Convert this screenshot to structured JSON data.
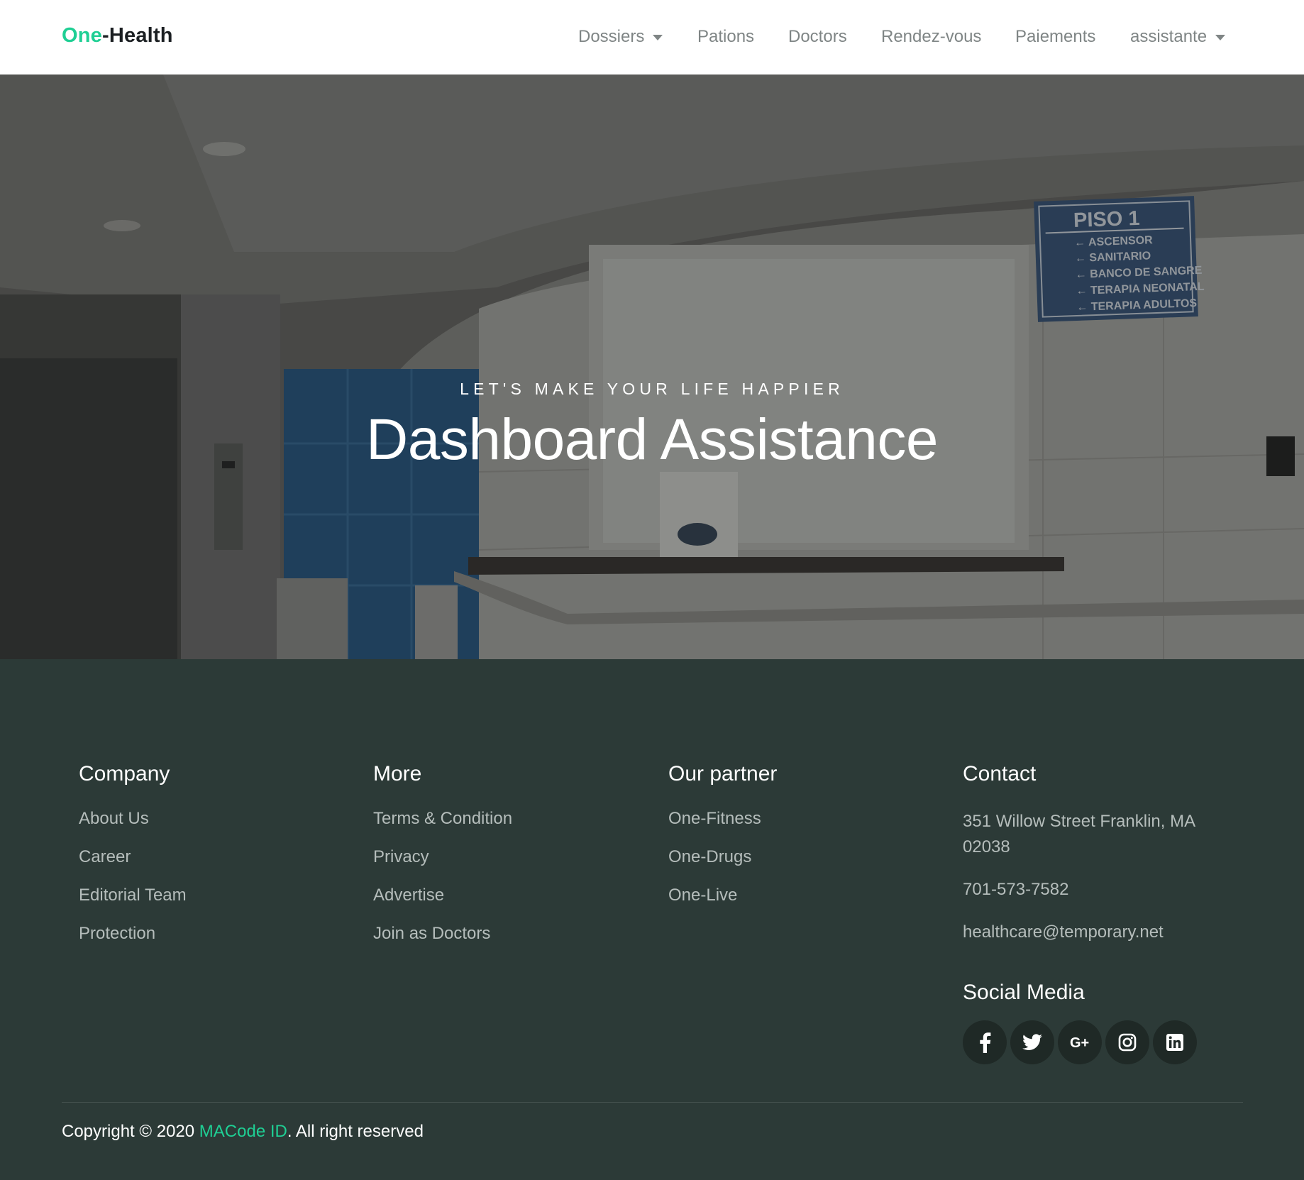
{
  "navbar": {
    "brand_part1": "One",
    "brand_part2": "-Health",
    "items": [
      {
        "label": "Dossiers",
        "dropdown": true
      },
      {
        "label": "Pations",
        "dropdown": false
      },
      {
        "label": "Doctors",
        "dropdown": false
      },
      {
        "label": "Rendez-vous",
        "dropdown": false
      },
      {
        "label": "Paiements",
        "dropdown": false
      },
      {
        "label": "assistante",
        "dropdown": true
      }
    ]
  },
  "hero": {
    "subtitle": "LET'S MAKE YOUR LIFE HAPPIER",
    "title": "Dashboard Assistance",
    "sign": {
      "heading": "PISO 1",
      "lines": [
        "ASCENSOR",
        "SANITARIO",
        "BANCO DE SANGRE",
        "TERAPIA NEONATAL",
        "TERAPIA ADULTOS"
      ]
    }
  },
  "footer": {
    "company": {
      "title": "Company",
      "links": [
        "About Us",
        "Career",
        "Editorial Team",
        "Protection"
      ]
    },
    "more": {
      "title": "More",
      "links": [
        "Terms & Condition",
        "Privacy",
        "Advertise",
        "Join as Doctors"
      ]
    },
    "partner": {
      "title": "Our partner",
      "links": [
        "One-Fitness",
        "One-Drugs",
        "One-Live"
      ]
    },
    "contact": {
      "title": "Contact",
      "address_line1": "351 Willow Street Franklin, MA",
      "address_line2": "02038",
      "phone": "701-573-7582",
      "email": "healthcare@temporary.net"
    },
    "social": {
      "title": "Social Media",
      "icons": [
        "facebook-icon",
        "twitter-icon",
        "google-plus-icon",
        "instagram-icon",
        "linkedin-icon"
      ]
    },
    "copyright": {
      "prefix": "Copyright © 2020 ",
      "brand": "MACode ID",
      "suffix": ". All right reserved"
    }
  },
  "colors": {
    "accent": "#1fcf94",
    "footer_bg": "#2c3a37",
    "nav_text": "#7f8585"
  }
}
